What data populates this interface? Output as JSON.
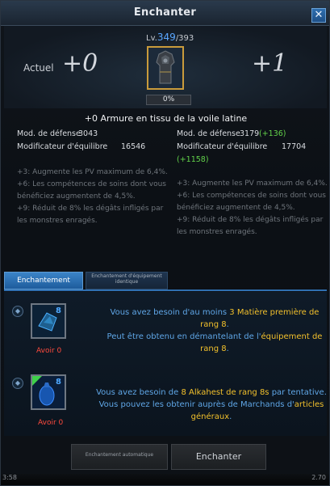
{
  "window": {
    "title": "Enchanter",
    "close_glyph": "✕"
  },
  "enchant": {
    "current_label": "Actuel",
    "current_level": "+0",
    "next_level": "+1",
    "level_prefix": "Lv.",
    "level_current": "349",
    "level_max": "/393",
    "progress_text": "0%",
    "progress_value": 0,
    "item_name": "+0 Armure en tissu de la voile latine",
    "item_icon": "cloth-armor-icon"
  },
  "stats": {
    "current": [
      {
        "label": "Mod. de défense",
        "value": "3043",
        "bonus": ""
      },
      {
        "label": "Modificateur d'équilibre",
        "value": "16546",
        "bonus": ""
      }
    ],
    "next": [
      {
        "label": "Mod. de défense",
        "value": "3179",
        "bonus": "(+136)"
      },
      {
        "label": "Modificateur d'équilibre",
        "value": "17704",
        "bonus": "(+1158)"
      }
    ]
  },
  "effects": {
    "current": "+3: Augmente les PV maximum de 6,4%.\n+6: Les compétences de soins dont vous bénéficiez augmentent de 4,5%.\n+9: Réduit de 8% les dégâts infligés par les monstres enragés.",
    "next": "+3: Augmente les PV maximum de 6,4%.\n+6: Les compétences de soins dont vous bénéficiez augmentent de 4,5%.\n+9: Réduit de 8% les dégâts infligés par les monstres enragés."
  },
  "tabs": [
    {
      "label": "Enchantement normal",
      "active": true
    },
    {
      "label": "Enchantement d'équipement identique",
      "active": false
    }
  ],
  "materials": [
    {
      "icon": "raw-material-icon",
      "rank": "8",
      "have": "Avoir 0",
      "line1_a": "Vous avez besoin d'au moins ",
      "line1_b": "3 Matière première de rang 8",
      "line1_c": ".",
      "line2_a": "Peut être obtenu en démantelant de l'",
      "line2_b": "équipement de rang 8",
      "line2_c": "."
    },
    {
      "icon": "alkahest-icon",
      "rank": "8",
      "have": "Avoir 0",
      "line1_a": "Vous avez besoin de ",
      "line1_b": "8 Alkahest de rang 8s",
      "line1_c": " par tentative.",
      "line2_a": "Vous pouvez les obtenir auprès de Marchands d'",
      "line2_b": "articles généraux",
      "line2_c": "."
    }
  ],
  "buttons": {
    "auto": "Enchantement automatique",
    "enchant": "Enchanter"
  },
  "footer": {
    "left": "3:58",
    "right": "2.70"
  },
  "colors": {
    "accent_blue": "#2f6fb0",
    "gold": "#f2c02c",
    "green": "#62d24a",
    "red": "#ff4a3d"
  }
}
